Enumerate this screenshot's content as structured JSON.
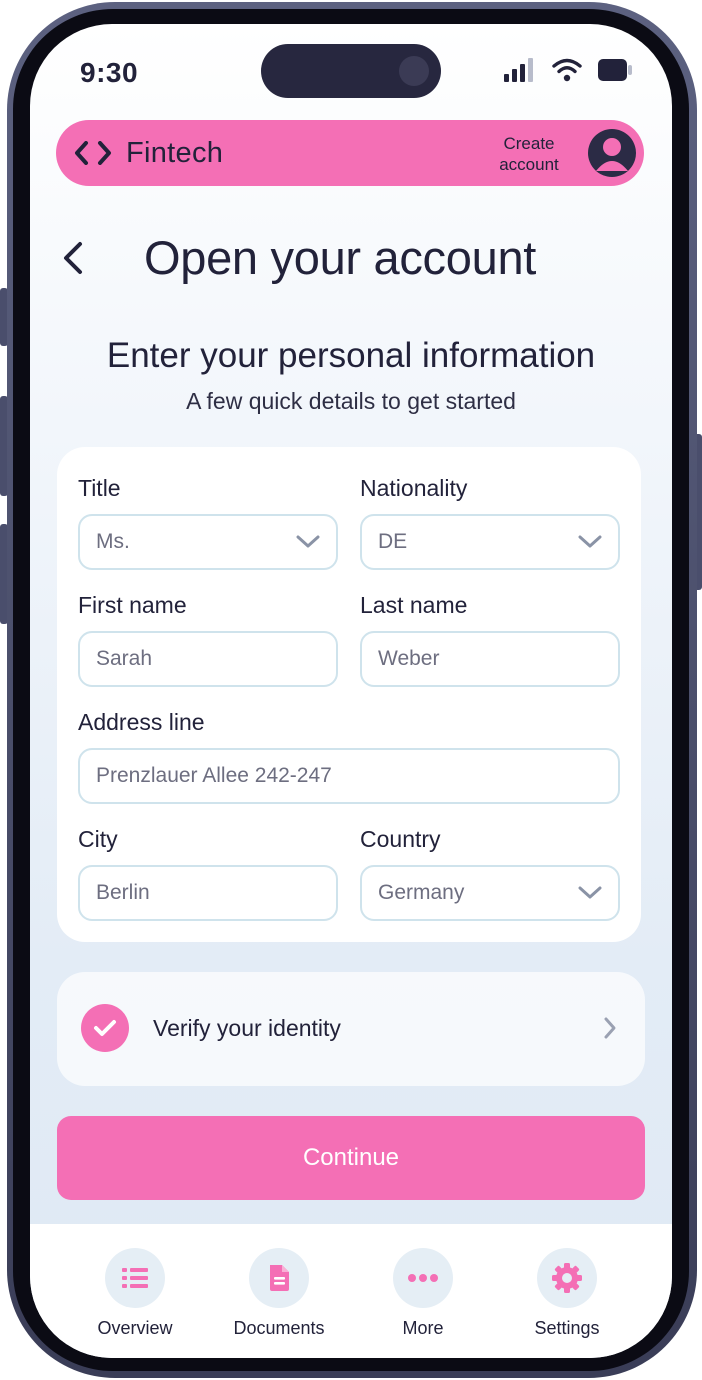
{
  "status_bar": {
    "time": "9:30"
  },
  "header": {
    "brand": "Fintech",
    "create_account": "Create account"
  },
  "page": {
    "title": "Open your account",
    "section_title": "Enter your personal information",
    "section_subtitle": "A few quick details to get started"
  },
  "form": {
    "title": {
      "label": "Title",
      "value": "Ms."
    },
    "nationality": {
      "label": "Nationality",
      "value": "DE"
    },
    "first_name": {
      "label": "First name",
      "value": "Sarah"
    },
    "last_name": {
      "label": "Last name",
      "value": "Weber"
    },
    "address": {
      "label": "Address line",
      "value": "Prenzlauer Allee 242-247"
    },
    "city": {
      "label": "City",
      "value": "Berlin"
    },
    "country": {
      "label": "Country",
      "value": "Germany"
    }
  },
  "verify": {
    "label": "Verify your identity",
    "completed": true
  },
  "continue_label": "Continue",
  "nav": [
    {
      "label": "Overview",
      "icon": "list-icon"
    },
    {
      "label": "Documents",
      "icon": "document-icon"
    },
    {
      "label": "More",
      "icon": "more-icon"
    },
    {
      "label": "Settings",
      "icon": "gear-icon"
    }
  ],
  "colors": {
    "accent": "#f46fb5",
    "text": "#22223a",
    "field_border": "#cfe3ec",
    "nav_circle": "#e5eef5"
  }
}
